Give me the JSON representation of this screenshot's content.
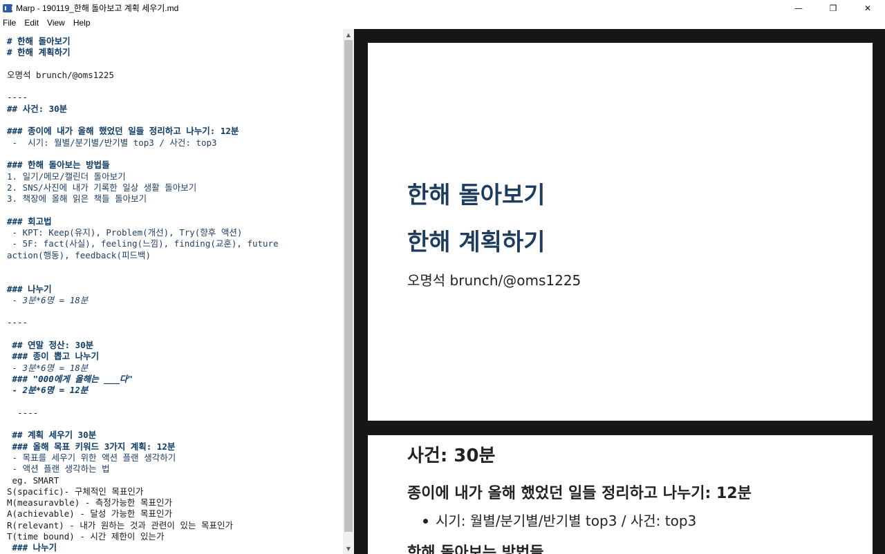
{
  "window": {
    "title": "Marp - 190119_한해 돌아보고 계획 세우기.md",
    "controls": {
      "minimize": "—",
      "maximize": "❐",
      "close": "✕"
    }
  },
  "menu": [
    "File",
    "Edit",
    "View",
    "Help"
  ],
  "editor": {
    "lines": [
      {
        "text": "# 한해 돌아보기",
        "style": "h"
      },
      {
        "text": "# 한해 계획하기",
        "style": "h"
      },
      {
        "text": "",
        "style": ""
      },
      {
        "text": "오명석 brunch/@oms1225",
        "style": ""
      },
      {
        "text": "",
        "style": ""
      },
      {
        "text": "----",
        "style": "sep"
      },
      {
        "text": "## 사건: 30분",
        "style": "h"
      },
      {
        "text": "",
        "style": ""
      },
      {
        "text": "### 종이에 내가 올해 했었던 일들 정리하고 나누기: 12분",
        "style": "h"
      },
      {
        "text": " -  시기: 월별/분기별/반기별 top3 / 사건: top3",
        "style": "li"
      },
      {
        "text": "",
        "style": ""
      },
      {
        "text": "### 한해 돌아보는 방법들",
        "style": "h"
      },
      {
        "text": "1. 일기/메모/캘린더 돌아보기",
        "style": "li"
      },
      {
        "text": "2. SNS/사진에 내가 기록한 일상 생활 돌아보기",
        "style": "li"
      },
      {
        "text": "3. 책장에 올해 읽은 책들 돌아보기",
        "style": "li"
      },
      {
        "text": "",
        "style": ""
      },
      {
        "text": "### 회고법",
        "style": "h"
      },
      {
        "text": " - KPT: Keep(유지), Problem(개선), Try(향후 액션)",
        "style": "li"
      },
      {
        "text": " - 5F: fact(사실), feeling(느낌), finding(교훈), future",
        "style": "li"
      },
      {
        "text": "action(행동), feedback(피드백)",
        "style": "li"
      },
      {
        "text": "",
        "style": ""
      },
      {
        "text": "",
        "style": ""
      },
      {
        "text": "### 나누기",
        "style": "h"
      },
      {
        "text": " - 3분*6명 = 18분",
        "style": "it"
      },
      {
        "text": "",
        "style": ""
      },
      {
        "text": "----",
        "style": "sep"
      },
      {
        "text": "",
        "style": ""
      },
      {
        "text": " ## 연말 정산: 30분",
        "style": "h"
      },
      {
        "text": " ### 종이 뽑고 나누기",
        "style": "h"
      },
      {
        "text": " - 3분*6명 = 18분",
        "style": "it"
      },
      {
        "text": " ### \"000에게 올해는 ___다\"",
        "style": "bi"
      },
      {
        "text": " - 2분*6명 = 12분",
        "style": "bi"
      },
      {
        "text": "",
        "style": ""
      },
      {
        "text": "  ----",
        "style": "sep"
      },
      {
        "text": "",
        "style": ""
      },
      {
        "text": " ## 계획 세우기 30분",
        "style": "h"
      },
      {
        "text": " ### 올해 목표 키워드 3가지 계획: 12분",
        "style": "h"
      },
      {
        "text": " - 목표를 세우기 위한 액션 플랜 생각하기",
        "style": "li"
      },
      {
        "text": " - 액션 플랜 생각하는 법",
        "style": "li"
      },
      {
        "text": " eg. SMART",
        "style": ""
      },
      {
        "text": "S(spacific)- 구체적인 목표인가",
        "style": ""
      },
      {
        "text": "M(measuravble) - 측정가능한 목표인가",
        "style": ""
      },
      {
        "text": "A(achievable) - 달성 가능한 목표인가",
        "style": ""
      },
      {
        "text": "R(relevant) - 내가 원하는 것과 관련이 있는 목표인가",
        "style": ""
      },
      {
        "text": "T(time bound) - 시간 제한이 있는가",
        "style": ""
      },
      {
        "text": " ### 나누기",
        "style": "h"
      }
    ]
  },
  "scrollbar": {
    "up": "▲",
    "down": "▼"
  },
  "preview": {
    "slide1": {
      "h1_a": "한해 돌아보기",
      "h1_b": "한해 계획하기",
      "author": "오명석 brunch/@oms1225"
    },
    "slide2": {
      "h2": "사건: 30분",
      "h3_a": "종이에 내가 올해 했었던 일들 정리하고 나누기: 12분",
      "bullet": "시기: 월별/분기별/반기별 top3 / 사건: top3",
      "h3_b": "한해 돌아보는 방법들"
    }
  }
}
